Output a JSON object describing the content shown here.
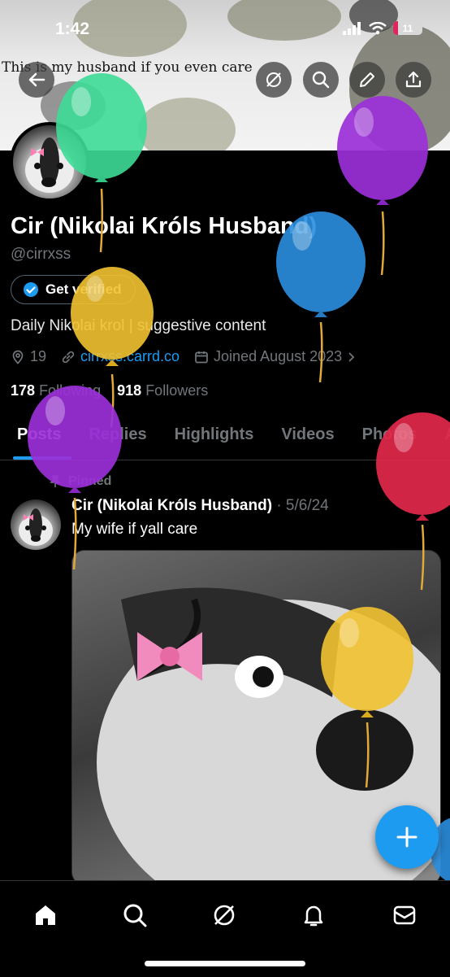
{
  "status_bar": {
    "time": "1:42",
    "battery": "11"
  },
  "banner": {
    "caption": "This is my husband if you even care"
  },
  "header_buttons": [
    "back-icon",
    "grok-icon",
    "search-icon",
    "edit-icon",
    "share-icon"
  ],
  "profile": {
    "name": "Cir (Nikolai Króls Husband)",
    "handle": "@cirrxss",
    "verify_label": "Get verified",
    "bio": "Daily Nikolai krol | suggestive content",
    "location": "19",
    "link": "cirrxss.carrd.co",
    "joined": "Joined August 2023",
    "following_count": "178",
    "following_label": "Following",
    "followers_count": "918",
    "followers_label": "Followers"
  },
  "tabs": [
    "Posts",
    "Replies",
    "Highlights",
    "Videos",
    "Photos",
    "Ar"
  ],
  "post": {
    "pinned_label": "Pinned",
    "author": "Cir (Nikolai Króls Husband)",
    "date": "· 5/6/24",
    "text": "My wife if yall care"
  },
  "bottom_nav": [
    "home-icon",
    "search-icon",
    "grok-icon",
    "bell-icon",
    "mail-icon"
  ],
  "colors": {
    "accent": "#1d9bf0",
    "balloon_green": "#3ddc97",
    "balloon_purple": "#9b30d9",
    "balloon_blue": "#2b8fe0",
    "balloon_yellow": "#f2c230",
    "balloon_red": "#e3284b"
  }
}
